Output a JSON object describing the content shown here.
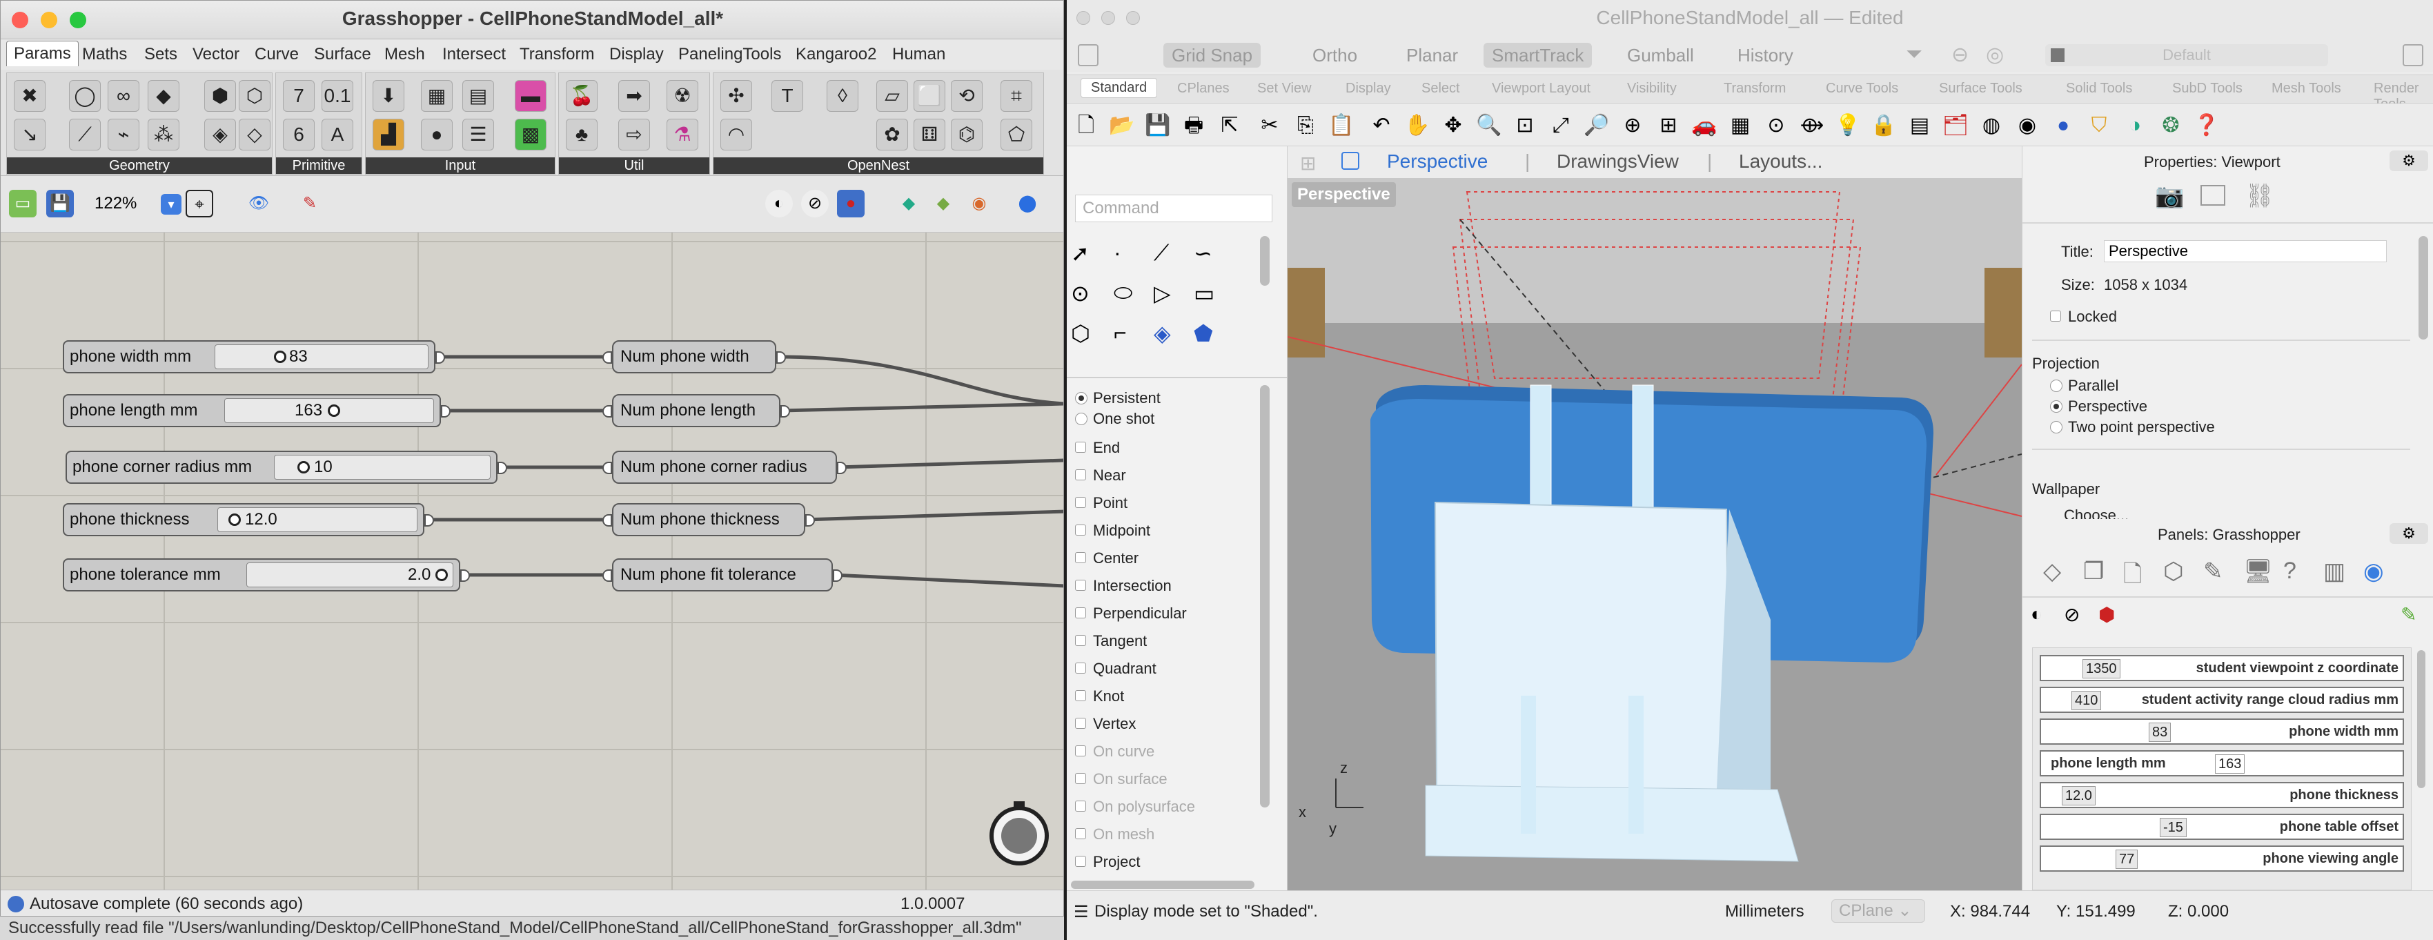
{
  "grasshopper": {
    "title": "Grasshopper - CellPhoneStandModel_all*",
    "menu_tabs": [
      "Params",
      "Maths",
      "Sets",
      "Vector",
      "Curve",
      "Surface",
      "Mesh",
      "Intersect",
      "Transform",
      "Display",
      "PanelingTools",
      "Kangaroo2",
      "Human"
    ],
    "ribbon_groups": [
      "Geometry",
      "Primitive",
      "Input",
      "Util",
      "OpenNest"
    ],
    "zoom": "122%",
    "sliders": [
      {
        "name": "phone width mm",
        "value": "83",
        "output": "Num phone width"
      },
      {
        "name": "phone length mm",
        "value": "163",
        "output": "Num phone length"
      },
      {
        "name": "phone corner radius mm",
        "value": "10",
        "output": "Num phone corner radius"
      },
      {
        "name": "phone thickness",
        "value": "12.0",
        "output": "Num phone thickness"
      },
      {
        "name": "phone tolerance mm",
        "value": "2.0",
        "output": "Num phone fit tolerance"
      }
    ],
    "status_left": "Autosave complete (60 seconds ago)",
    "status_right": "1.0.0007",
    "message": "Successfully read file \"/Users/wanlunding/Desktop/CellPhoneStand_Model/CellPhoneStand_all/CellPhoneStand_forGrasshopper_all.3dm\""
  },
  "rhino": {
    "title": "CellPhoneStandModel_all",
    "title_state": "— Edited",
    "modes": [
      "Grid Snap",
      "Ortho",
      "Planar",
      "SmartTrack",
      "Gumball",
      "History"
    ],
    "layer_placeholder": "Default",
    "tabs": [
      "Standard",
      "CPlanes",
      "Set View",
      "Display",
      "Select",
      "Viewport Layout",
      "Visibility",
      "Transform",
      "Curve Tools",
      "Surface Tools",
      "Solid Tools",
      "SubD Tools",
      "Mesh Tools",
      "Render Tools"
    ],
    "command_placeholder": "Command",
    "snap_mode": [
      "Persistent",
      "One shot"
    ],
    "osnaps": [
      "End",
      "Near",
      "Point",
      "Midpoint",
      "Center",
      "Intersection",
      "Perpendicular",
      "Tangent",
      "Quadrant",
      "Knot",
      "Vertex"
    ],
    "osnaps_disabled": [
      "On curve",
      "On surface",
      "On polysurface",
      "On mesh"
    ],
    "osnap_project": "Project",
    "viewport_tabs": [
      "Perspective",
      "DrawingsView",
      "Layouts..."
    ],
    "viewport_label": "Perspective",
    "axes": {
      "x": "x",
      "y": "y",
      "z": "z"
    },
    "properties": {
      "header": "Properties: Viewport",
      "title_label": "Title:",
      "title_value": "Perspective",
      "size_label": "Size:",
      "size_value": "1058 x 1034",
      "locked": "Locked",
      "projection_heading": "Projection",
      "projection_options": [
        "Parallel",
        "Perspective",
        "Two point perspective"
      ],
      "projection_selected": "Perspective",
      "wallpaper_heading": "Wallpaper",
      "wallpaper_choose": "Choose..."
    },
    "panels": {
      "header": "Panels: Grasshopper",
      "rows": [
        {
          "value": "1350",
          "label": "student viewpoint z coordinate"
        },
        {
          "value": "410",
          "label": "student activity range cloud radius mm"
        },
        {
          "value": "83",
          "label": "phone width mm"
        },
        {
          "value": "163",
          "label": "phone length mm"
        },
        {
          "value": "12.0",
          "label": "phone thickness"
        },
        {
          "value": "-15",
          "label": "phone table offset"
        },
        {
          "value": "77",
          "label": "phone viewing angle"
        }
      ]
    },
    "status": {
      "message": "Display mode set to \"Shaded\".",
      "units": "Millimeters",
      "cplane": "CPlane",
      "x": "X: 984.744",
      "y": "Y: 151.499",
      "z": "Z: 0.000"
    }
  },
  "colors": {
    "phone": "#3b82c9",
    "stand": "#e4f2fb",
    "accent": "#2f6fd0",
    "close": "#fe5f57",
    "min": "#febc2e",
    "max": "#28c840"
  }
}
